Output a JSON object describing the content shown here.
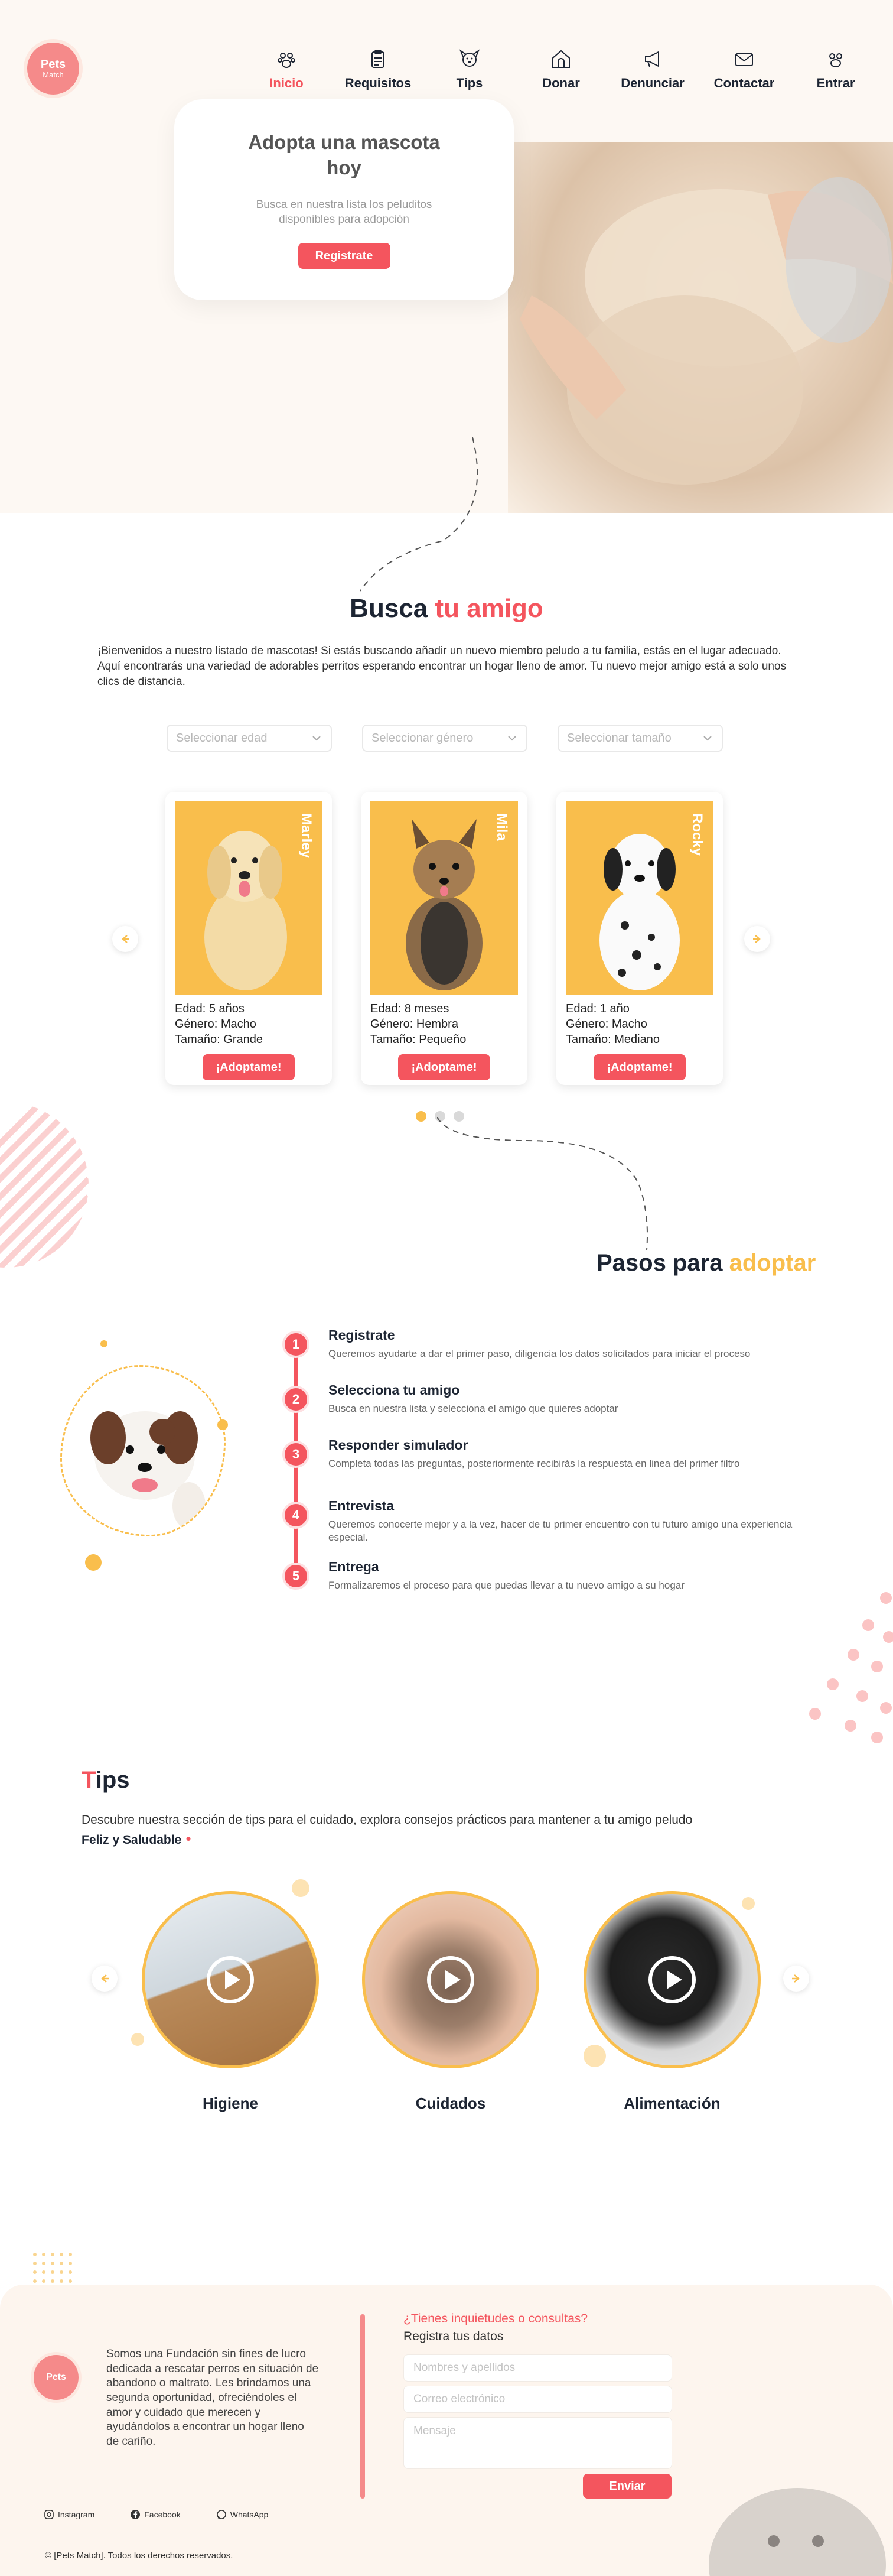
{
  "brand": {
    "logo_line1": "Pets",
    "logo_line2": "Match"
  },
  "nav": {
    "items": [
      {
        "label": "Inicio",
        "icon": "paw-home-icon",
        "active": true
      },
      {
        "label": "Requisitos",
        "icon": "clipboard-icon"
      },
      {
        "label": "Tips",
        "icon": "dog-face-icon"
      },
      {
        "label": "Donar",
        "icon": "dog-house-icon"
      },
      {
        "label": "Denunciar",
        "icon": "megaphone-icon"
      },
      {
        "label": "Contactar",
        "icon": "envelope-icon"
      },
      {
        "label": "Entrar",
        "icon": "login-icon"
      }
    ]
  },
  "hero": {
    "title": "Adopta una mascota hoy",
    "subtitle": "Busca en nuestra lista los peluditos disponibles para adopción",
    "cta": "Registrate"
  },
  "busca": {
    "title_plain": "Busca",
    "title_accent": "tu amigo",
    "intro": "¡Bienvenidos a nuestro listado de mascotas! Si estás buscando añadir un nuevo miembro peludo a tu familia, estás en el lugar adecuado. Aquí encontrarás una variedad de adorables perritos esperando encontrar un hogar lleno de amor.  Tu nuevo mejor amigo está a solo unos clics de distancia.",
    "filters": [
      "Seleccionar edad",
      "Seleccionar género",
      "Seleccionar tamaño"
    ],
    "pets": [
      {
        "name": "Marley",
        "edad": "Edad: 5 años",
        "genero": "Género: Macho",
        "tamano": "Tamaño: Grande",
        "cta": "¡Adoptame!"
      },
      {
        "name": "Mila",
        "edad": "Edad: 8 meses",
        "genero": "Género: Hembra",
        "tamano": "Tamaño: Pequeño",
        "cta": "¡Adoptame!"
      },
      {
        "name": "Rocky",
        "edad": "Edad: 1 año",
        "genero": "Género: Macho",
        "tamano": "Tamaño: Mediano",
        "cta": "¡Adoptame!"
      }
    ]
  },
  "pasos": {
    "title_plain": "Pasos para",
    "title_accent": "adoptar",
    "steps": [
      {
        "num": "1",
        "title": "Registrate",
        "text": "Queremos ayudarte a dar el primer paso, diligencia los datos solicitados para iniciar el proceso"
      },
      {
        "num": "2",
        "title": "Selecciona tu amigo",
        "text": "Busca en nuestra lista y selecciona el amigo que quieres adoptar"
      },
      {
        "num": "3",
        "title": "Responder simulador",
        "text": "Completa todas las preguntas, posteriormente recibirás la respuesta en linea del primer filtro"
      },
      {
        "num": "4",
        "title": "Entrevista",
        "text": "Queremos conocerte mejor y a la vez, hacer de tu primer encuentro con tu futuro amigo una experiencia especial."
      },
      {
        "num": "5",
        "title": "Entrega",
        "text": "Formalizaremos el proceso para que puedas llevar a tu nuevo amigo a su hogar"
      }
    ]
  },
  "tips": {
    "title_first": "T",
    "title_rest": "ips",
    "intro": "Descubre nuestra sección de tips para el cuidado, explora consejos prácticos para mantener a tu amigo peludo",
    "intro_bold": "Feliz y Saludable",
    "items": [
      {
        "label": "Higiene"
      },
      {
        "label": "Cuidados"
      },
      {
        "label": "Alimentación"
      }
    ]
  },
  "footer": {
    "about": "Somos una Fundación sin fines de lucro dedicada a rescatar perros en situación de abandono o maltrato. Les brindamos una segunda oportunidad, ofreciéndoles el amor y cuidado que merecen y ayudándolos a encontrar un hogar lleno de cariño.",
    "form_question": "¿Tienes inquietudes o consultas?",
    "form_subtitle": "Registra tus datos",
    "name_placeholder": "Nombres y apellidos",
    "email_placeholder": "Correo electrónico",
    "message_placeholder": "Mensaje",
    "send": "Enviar",
    "socials": [
      "Instagram",
      "Facebook",
      "WhatsApp"
    ],
    "copyright": "© [Pets Match]. Todos los derechos reservados."
  },
  "colors": {
    "accent_red": "#f4555e",
    "accent_yellow": "#f9be4c",
    "cream": "#fdf8f3"
  }
}
